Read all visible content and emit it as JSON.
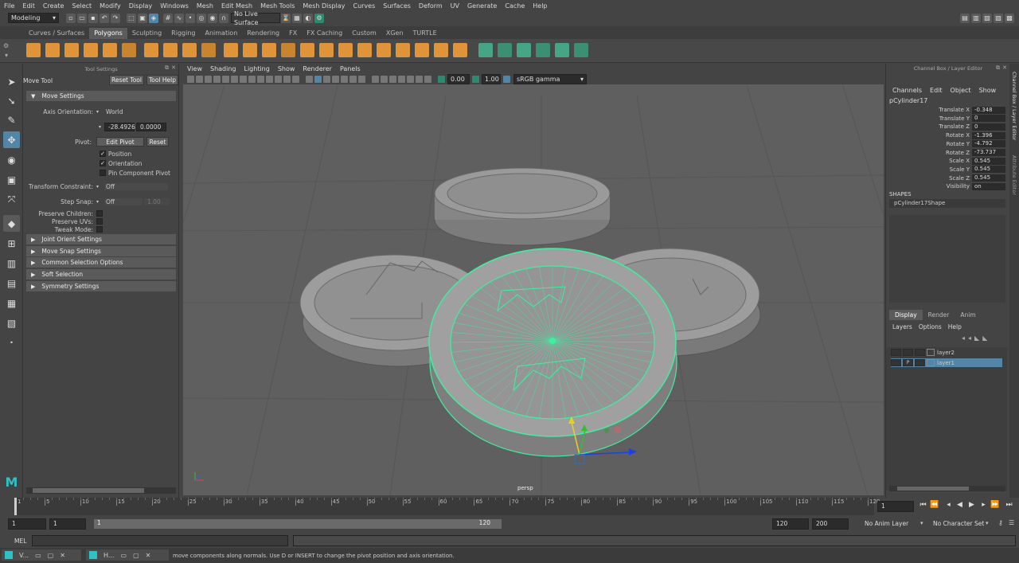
{
  "menubar": [
    "File",
    "Edit",
    "Create",
    "Select",
    "Modify",
    "Display",
    "Windows",
    "Mesh",
    "Edit Mesh",
    "Mesh Tools",
    "Mesh Display",
    "Curves",
    "Surfaces",
    "Deform",
    "UV",
    "Generate",
    "Cache",
    "Help"
  ],
  "status": {
    "mode": "Modeling",
    "live_surface": "No Live Surface"
  },
  "shelf_tabs": [
    "Curves / Surfaces",
    "Polygons",
    "Sculpting",
    "Rigging",
    "Animation",
    "Rendering",
    "FX",
    "FX Caching",
    "Custom",
    "XGen",
    "TURTLE"
  ],
  "shelf_active": "Polygons",
  "tool_settings": {
    "panel_title": "Tool Settings",
    "tool_name": "Move Tool",
    "reset_tool": "Reset Tool",
    "tool_help": "Tool Help",
    "move_settings": "Move Settings",
    "axis_orientation_label": "Axis Orientation:",
    "axis_orientation_value": "World",
    "coord_a": "-28.4926",
    "coord_b": "0.0000",
    "pivot_label": "Pivot:",
    "edit_pivot": "Edit Pivot",
    "reset": "Reset",
    "position": "Position",
    "orientation": "Orientation",
    "pin_component_pivot": "Pin Component Pivot",
    "transform_constraint_label": "Transform Constraint:",
    "transform_constraint_value": "Off",
    "step_snap_label": "Step Snap:",
    "step_snap_value": "Off",
    "step_snap_num": "1.00",
    "preserve_children": "Preserve Children:",
    "preserve_uvs": "Preserve UVs:",
    "tweak_mode": "Tweak Mode:",
    "sections": [
      "Joint Orient Settings",
      "Move Snap Settings",
      "Common Selection Options",
      "Soft Selection",
      "Symmetry Settings"
    ]
  },
  "viewport": {
    "menu": [
      "View",
      "Shading",
      "Lighting",
      "Show",
      "Renderer",
      "Panels"
    ],
    "exposure": "0.00",
    "gamma": "1.00",
    "colorspace": "sRGB gamma",
    "camera": "persp"
  },
  "channel_box": {
    "title": "Channel Box / Layer Editor",
    "menu": [
      "Channels",
      "Edit",
      "Object",
      "Show"
    ],
    "object": "pCylinder17",
    "attributes": [
      {
        "name": "Translate X",
        "value": "-0.348"
      },
      {
        "name": "Translate Y",
        "value": "0"
      },
      {
        "name": "Translate Z",
        "value": "0"
      },
      {
        "name": "Rotate X",
        "value": "-1.396"
      },
      {
        "name": "Rotate Y",
        "value": "-4.792"
      },
      {
        "name": "Rotate Z",
        "value": "-73.737"
      },
      {
        "name": "Scale X",
        "value": "0.545"
      },
      {
        "name": "Scale Y",
        "value": "0.545"
      },
      {
        "name": "Scale Z",
        "value": "0.545"
      },
      {
        "name": "Visibility",
        "value": "on"
      }
    ],
    "shapes_label": "SHAPES",
    "shape_name": "pCylinder17Shape",
    "layer_tabs": [
      "Display",
      "Render",
      "Anim"
    ],
    "layer_menu": [
      "Layers",
      "Options",
      "Help"
    ],
    "layers": [
      {
        "name": "layer2",
        "selected": false
      },
      {
        "name": "layer1",
        "selected": true,
        "flag": "P"
      }
    ],
    "side_labels": [
      "Channel Box / Layer Editor",
      "Attribute Editor"
    ]
  },
  "timeline": {
    "ticks": [
      "1",
      "5",
      "10",
      "15",
      "20",
      "25",
      "30",
      "35",
      "40",
      "45",
      "50",
      "55",
      "60",
      "65",
      "70",
      "75",
      "80",
      "85",
      "90",
      "95",
      "100",
      "105",
      "110",
      "115",
      "120"
    ],
    "current_frame": "1",
    "range_start": "1",
    "range_inner_start": "1",
    "range_slider_start": "1",
    "range_slider_end": "120",
    "range_end": "120",
    "anim_end": "200",
    "anim_layer": "No Anim Layer",
    "character_set": "No Character Set"
  },
  "cmd": {
    "lang": "MEL"
  },
  "help_line": "move components along normals. Use D or INSERT to change the pivot position and axis orientation.",
  "taskbar": [
    {
      "label": "V..."
    },
    {
      "label": "H..."
    }
  ],
  "colors": {
    "selection": "#3cf0a0",
    "accent": "#5285a6",
    "bg": "#444444",
    "viewport": "#5f5f5f"
  }
}
